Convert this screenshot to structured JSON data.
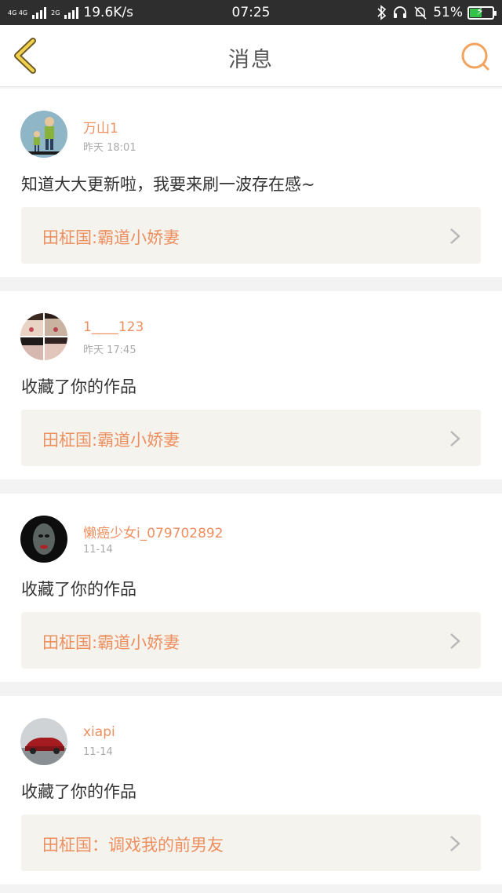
{
  "status_bar": {
    "net_top": "4G 4G",
    "net_bottom": "2G",
    "speed": "19.6K/s",
    "time": "07:25",
    "battery": "51%",
    "battery_level": 0.51
  },
  "header": {
    "title": "消息",
    "accent_color": "#f2a35e"
  },
  "messages": [
    {
      "username": "万山1",
      "time": "昨天 18:01",
      "text": "知道大大更新啦，我要来刷一波存在感~",
      "work": "田柾国:霸道小娇妻"
    },
    {
      "username": "1____123",
      "time": "昨天 17:45",
      "text": "收藏了你的作品",
      "work": "田柾国:霸道小娇妻"
    },
    {
      "username": "懒癌少女i_079702892",
      "time": "11-14",
      "text": "收藏了你的作品",
      "work": "田柾国:霸道小娇妻"
    },
    {
      "username": "xiapi",
      "time": "11-14",
      "text": "收藏了你的作品",
      "work": "田柾国：调戏我的前男友"
    }
  ]
}
